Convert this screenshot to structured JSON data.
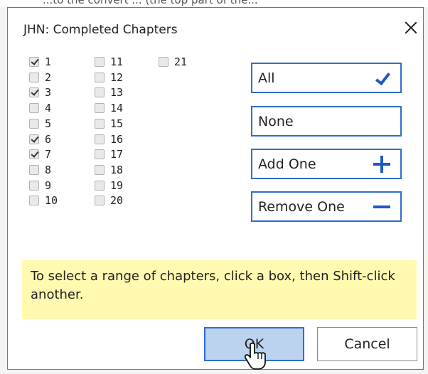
{
  "background_text": "...to the convert ... (the top part of the...",
  "dialog": {
    "title": "JHN: Completed Chapters",
    "chapters": [
      {
        "label": "1",
        "checked": true
      },
      {
        "label": "2",
        "checked": false
      },
      {
        "label": "3",
        "checked": true
      },
      {
        "label": "4",
        "checked": false
      },
      {
        "label": "5",
        "checked": false
      },
      {
        "label": "6",
        "checked": true
      },
      {
        "label": "7",
        "checked": true
      },
      {
        "label": "8",
        "checked": false
      },
      {
        "label": "9",
        "checked": false
      },
      {
        "label": "10",
        "checked": false
      },
      {
        "label": "11",
        "checked": false
      },
      {
        "label": "12",
        "checked": false
      },
      {
        "label": "13",
        "checked": false
      },
      {
        "label": "14",
        "checked": false
      },
      {
        "label": "15",
        "checked": false
      },
      {
        "label": "16",
        "checked": false
      },
      {
        "label": "17",
        "checked": false
      },
      {
        "label": "18",
        "checked": false
      },
      {
        "label": "19",
        "checked": false
      },
      {
        "label": "20",
        "checked": false
      },
      {
        "label": "21",
        "checked": false
      }
    ],
    "buttons": {
      "all": "All",
      "none": "None",
      "add_one": "Add One",
      "remove_one": "Remove One"
    },
    "hint": "To select a range of chapters, click a box, then Shift-click another.",
    "ok": "OK",
    "cancel": "Cancel"
  },
  "colors": {
    "accent": "#1f58c8",
    "hint_background": "#fffab0",
    "ok_background": "#bcd3f0"
  },
  "icons": {
    "close": "close-icon",
    "all": "checkmark-icon",
    "add_one": "plus-icon",
    "remove_one": "minus-icon",
    "cursor": "hand-pointer-icon"
  }
}
